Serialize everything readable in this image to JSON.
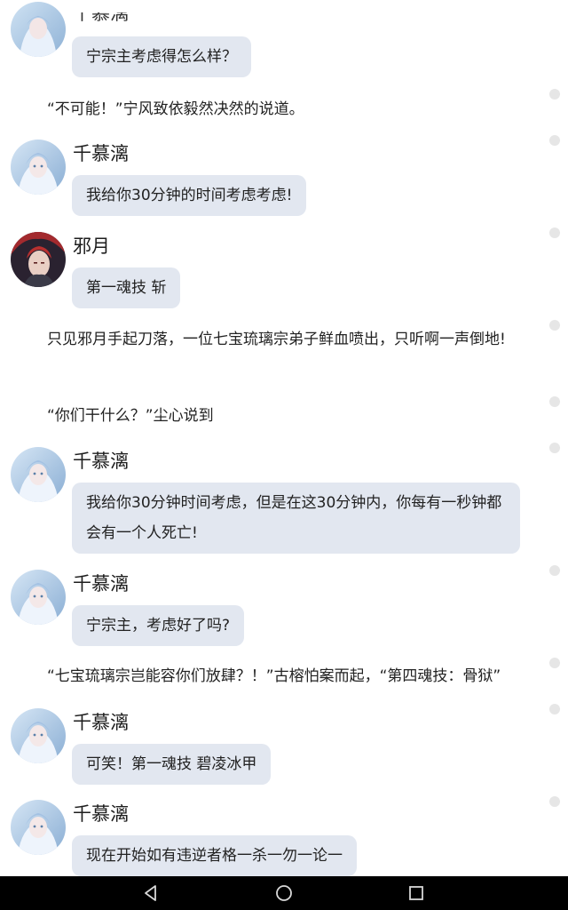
{
  "messages": [
    {
      "speaker": "千慕漓",
      "text": "宁宗主考虑得怎么样？"
    },
    {
      "speaker": "千慕漓",
      "text": "我给你30分钟的时间考虑考虑!"
    },
    {
      "speaker": "邪月",
      "text": "第一魂技  斩"
    },
    {
      "speaker": "千慕漓",
      "text": "我给你30分钟时间考虑，但是在这30分钟内，你每有一秒钟都会有一个人死亡!"
    },
    {
      "speaker": "千慕漓",
      "text": "宁宗主，考虑好了吗?"
    },
    {
      "speaker": "千慕漓",
      "text": "可笑！第一魂技  碧凌冰甲"
    },
    {
      "speaker": "千慕漓",
      "text": "现在开始如有违逆者格一杀一勿一论一"
    }
  ],
  "narration": [
    "“不可能！”宁风致依毅然决然的说道。",
    "只见邪月手起刀落，一位七宝琉璃宗弟子鲜血喷出，只听啊一声倒地!",
    "“你们干什么？”尘心说到",
    "“七宝琉璃宗岂能容你们放肆？！”古榕怕案而起，“第四魂技：骨狱”"
  ],
  "top_partial_name": "千慕漓",
  "colors": {
    "bubble": "#e2e7f0",
    "navbar": "#000000",
    "scroll_dot": "#e6e6e6"
  },
  "icons": {
    "nav_back": "back-triangle-icon",
    "nav_home": "home-circle-icon",
    "nav_recents": "recents-square-icon"
  }
}
